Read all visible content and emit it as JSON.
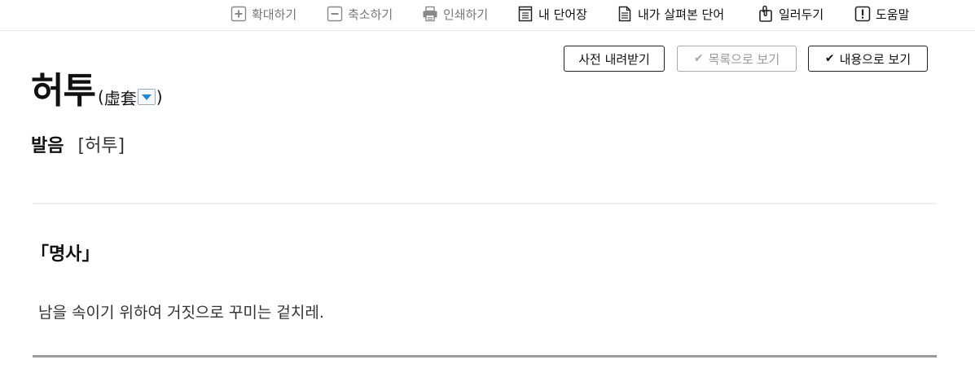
{
  "toolbar": {
    "items": [
      {
        "label": "확대하기",
        "icon": "zoom-in-icon"
      },
      {
        "label": "축소하기",
        "icon": "zoom-out-icon"
      },
      {
        "label": "인쇄하기",
        "icon": "printer-icon"
      },
      {
        "label": "내 단어장",
        "icon": "vocabulary-book-icon"
      },
      {
        "label": "내가 살펴본 단어",
        "icon": "document-icon"
      },
      {
        "label": "일러두기",
        "icon": "clipboard-icon"
      },
      {
        "label": "도움말",
        "icon": "help-icon"
      }
    ]
  },
  "actions": {
    "download_label": "사전 내려받기",
    "list_view_label": "목록으로 보기",
    "content_view_label": "내용으로 보기",
    "check_glyph": "✔"
  },
  "entry": {
    "headword": "허투",
    "hanja_open": "(",
    "hanja": "虛套",
    "hanja_close": ")",
    "pronunciation_label": "발음",
    "pronunciation": "[허투]",
    "part_of_speech": "「명사」",
    "definition": "남을 속이기 위하여 거짓으로 꾸미는 겉치레."
  },
  "colors": {
    "accent": "#1a8ae0",
    "muted_text": "#777777",
    "divider": "#9a9a9a"
  }
}
